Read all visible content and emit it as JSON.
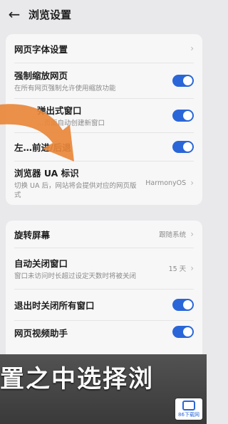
{
  "header": {
    "title": "浏览设置"
  },
  "card1": [
    {
      "id": "font",
      "label": "网页字体设置",
      "desc": "",
      "control": "chevron"
    },
    {
      "id": "force-zoom",
      "label": "强制缩放网页",
      "desc": "在所有网页强制允许使用缩放功能",
      "control": "toggle",
      "on": true
    },
    {
      "id": "popup",
      "label": "弹出式窗口",
      "desc": "…页面自动创建新窗口",
      "control": "toggle",
      "on": true
    },
    {
      "id": "swipe",
      "label": "左…前进/后退",
      "desc": "",
      "control": "toggle",
      "on": true
    },
    {
      "id": "ua",
      "label": "浏览器 UA 标识",
      "desc": "切换 UA 后，网站将会提供对应的网页版式",
      "control": "value",
      "value": "HarmonyOS"
    }
  ],
  "card2": [
    {
      "id": "rotate",
      "label": "旋转屏幕",
      "desc": "",
      "control": "value",
      "value": "跟随系统"
    },
    {
      "id": "auto-close",
      "label": "自动关闭窗口",
      "desc": "窗口未访问时长超过设定天数时将被关闭",
      "control": "value",
      "value": "15 天"
    },
    {
      "id": "exit-close",
      "label": "退出时关闭所有窗口",
      "desc": "",
      "control": "toggle",
      "on": true
    },
    {
      "id": "video",
      "label": "网页视频助手",
      "desc": "…",
      "control": "toggle",
      "on": true
    }
  ],
  "overlay": {
    "caption": "置之中选择浏",
    "watermark": "86下载网"
  },
  "colors": {
    "accent": "#2a66d8",
    "arrow": "#e8873a"
  }
}
